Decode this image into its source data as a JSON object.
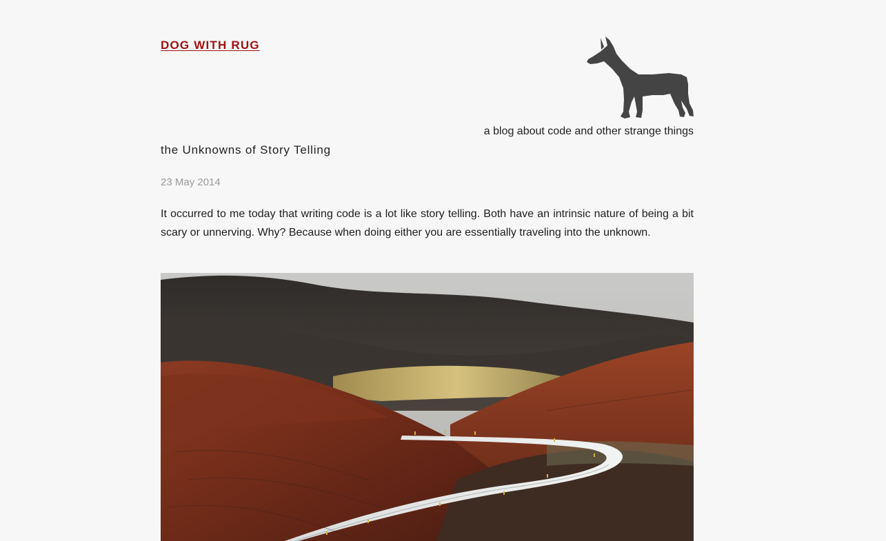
{
  "site": {
    "title": "DOG WITH RUG",
    "tagline": "a blog about code and other strange things"
  },
  "logo": {
    "icon": "doberman-dog-icon",
    "color": "#444444"
  },
  "post": {
    "title": "the Unknowns of Story Telling",
    "date": "23 May 2014",
    "body": "It occurred to me today that writing code is a lot like story telling. Both have an intrinsic nature of being a bit scary or unnerving. Why? Because when doing either you are essentially traveling into the unknown.",
    "image": {
      "subject": "winding-road-landscape-image"
    }
  },
  "colors": {
    "accent": "#a20f0f",
    "background": "#f7f7f7",
    "date": "#9a9a9a"
  }
}
